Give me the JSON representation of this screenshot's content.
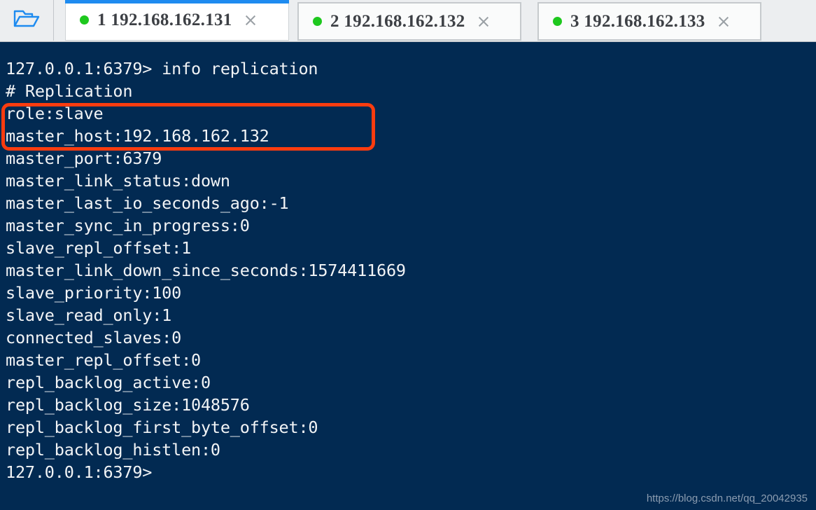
{
  "toolbar": {
    "folder_icon": "open-folder-icon",
    "folder_tooltip": "Open"
  },
  "tabs": [
    {
      "index": "1",
      "label": "1  192.168.162.131",
      "status_dot": "green",
      "active": true,
      "close_label": "×"
    },
    {
      "index": "2",
      "label": "2  192.168.162.132",
      "status_dot": "green",
      "active": false,
      "close_label": "×"
    },
    {
      "index": "3",
      "label": "3  192.168.162.133",
      "status_dot": "green",
      "active": false,
      "close_label": "×"
    }
  ],
  "terminal": {
    "prompt": "127.0.0.1:6379>",
    "command": "info replication",
    "lines": [
      "127.0.0.1:6379> info replication",
      "# Replication",
      "role:slave",
      "master_host:192.168.162.132",
      "master_port:6379",
      "master_link_status:down",
      "master_last_io_seconds_ago:-1",
      "master_sync_in_progress:0",
      "slave_repl_offset:1",
      "master_link_down_since_seconds:1574411669",
      "slave_priority:100",
      "slave_read_only:1",
      "connected_slaves:0",
      "master_repl_offset:0",
      "repl_backlog_active:0",
      "repl_backlog_size:1048576",
      "repl_backlog_first_byte_offset:0",
      "repl_backlog_histlen:0",
      "127.0.0.1:6379>"
    ],
    "text": "127.0.0.1:6379> info replication\n# Replication\nrole:slave\nmaster_host:192.168.162.132\nmaster_port:6379\nmaster_link_status:down\nmaster_last_io_seconds_ago:-1\nmaster_sync_in_progress:0\nslave_repl_offset:1\nmaster_link_down_since_seconds:1574411669\nslave_priority:100\nslave_read_only:1\nconnected_slaves:0\nmaster_repl_offset:0\nrepl_backlog_active:0\nrepl_backlog_size:1048576\nrepl_backlog_first_byte_offset:0\nrepl_backlog_histlen:0\n127.0.0.1:6379>",
    "highlighted_lines": [
      "role:slave",
      "master_host:192.168.162.132"
    ]
  },
  "watermark": {
    "text": "https://blog.csdn.net/qq_20042935"
  },
  "colors": {
    "terminal_background": "#022a52",
    "terminal_text": "#f2f4f6",
    "tabbar_background": "#eceef0",
    "active_tab_accent": "#1e8bf0",
    "status_dot": "#1ec81e",
    "annotation_red": "#fb3c0f",
    "folder_icon": "#1e8bf0"
  }
}
